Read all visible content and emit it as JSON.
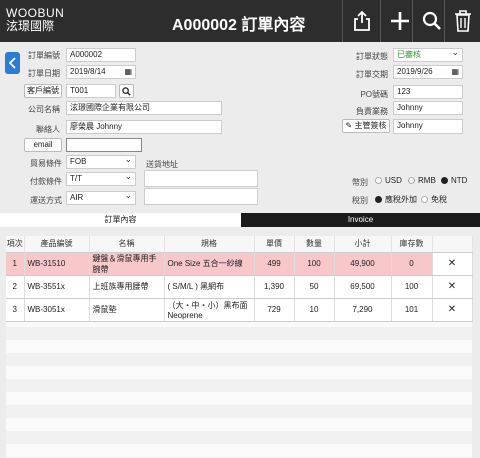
{
  "header": {
    "brand_en": "WOOBUN",
    "brand_zh": "泫璟國際",
    "title": "A000002 訂單內容",
    "icons": [
      "share-icon",
      "plus-icon",
      "search-icon",
      "trash-icon"
    ]
  },
  "form": {
    "order_no_label": "訂單編號",
    "order_no": "A000002",
    "order_date_label": "訂單日期",
    "order_date": "2019/8/14",
    "customer_btn": "客戶編號",
    "customer_no": "T001",
    "company_label": "公司名稱",
    "company": "泫璟國際企業有限公司",
    "contact_label": "聯絡人",
    "contact": "廖榮晨 Johnny",
    "email_btn": "email",
    "email": "",
    "trade_label": "貿易條件",
    "trade": "FOB",
    "payment_label": "付款條件",
    "payment": "T/T",
    "shipping_label": "運送方式",
    "shipping": "AIR",
    "address_label": "送貨地址",
    "status_label": "訂單狀態",
    "status": "已審核",
    "delivery_label": "訂單交期",
    "delivery": "2019/9/26",
    "po_label": "PO號碼",
    "po": "123",
    "rep_label": "負責業務",
    "rep": "Johnny",
    "sign_btn": "主管簽核",
    "sign": "Johnny",
    "currency_label": "幣別",
    "currency_options": [
      "USD",
      "RMB",
      "NTD"
    ],
    "currency_selected": "NTD",
    "tax_label": "稅別",
    "tax_options": [
      "應稅外加",
      "免稅"
    ],
    "tax_selected": "應稅外加",
    "status_color": "#2e9d2e"
  },
  "tabs": [
    "訂單內容",
    "Invoice"
  ],
  "table": {
    "headers": [
      "項次",
      "產品編號",
      "名稱",
      "規格",
      "單價",
      "數量",
      "小計",
      "庫存數"
    ],
    "rows": [
      {
        "idx": "1",
        "code": "WB-31510",
        "name": "鍵盤＆滑鼠專用手腕帶",
        "spec": "One Size 五合一紗線",
        "price": "499",
        "qty": "100",
        "subtotal": "49,900",
        "stock": "0"
      },
      {
        "idx": "2",
        "code": "WB-3551x",
        "name": "上班族專用腰帶",
        "spec": "( S/M/L ) 黑網布",
        "price": "1,390",
        "qty": "50",
        "subtotal": "69,500",
        "stock": "100"
      },
      {
        "idx": "3",
        "code": "WB-3051x",
        "name": "滑鼠墊",
        "spec": "（大・中・小）黑布面 Neoprene",
        "price": "729",
        "qty": "10",
        "subtotal": "7,290",
        "stock": "101"
      }
    ]
  }
}
